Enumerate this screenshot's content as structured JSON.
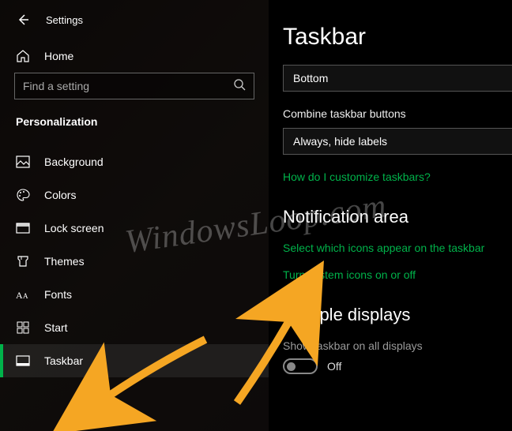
{
  "header": {
    "title": "Settings"
  },
  "sidebar": {
    "home": "Home",
    "search_placeholder": "Find a setting",
    "category": "Personalization",
    "items": [
      {
        "label": "Background"
      },
      {
        "label": "Colors"
      },
      {
        "label": "Lock screen"
      },
      {
        "label": "Themes"
      },
      {
        "label": "Fonts"
      },
      {
        "label": "Start"
      },
      {
        "label": "Taskbar"
      }
    ]
  },
  "main": {
    "title": "Taskbar",
    "location_value": "Bottom",
    "combine_label": "Combine taskbar buttons",
    "combine_value": "Always, hide labels",
    "link_customize": "How do I customize taskbars?",
    "notification_heading": "Notification area",
    "link_select_icons": "Select which icons appear on the taskbar",
    "link_system_icons": "Turn system icons on or off",
    "multiple_heading": "Multiple displays",
    "multiple_label": "Show taskbar on all displays",
    "multiple_toggle": "Off"
  },
  "watermark": "WindowsLoop.com"
}
